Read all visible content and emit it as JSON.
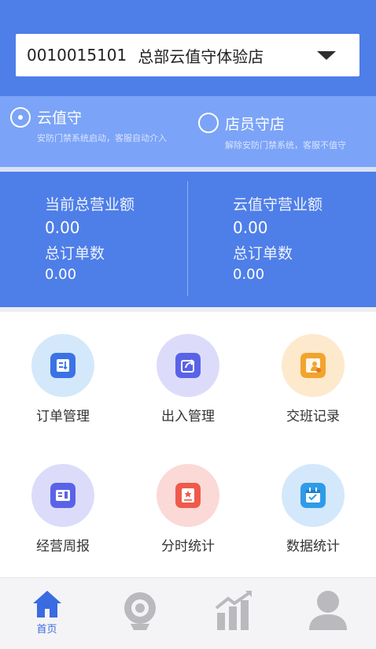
{
  "store": {
    "code": "0010015101",
    "name": "总部云值守体验店"
  },
  "modes": [
    {
      "title": "云值守",
      "desc": "安防门禁系统启动，客服自动介入",
      "selected": true
    },
    {
      "title": "店员守店",
      "desc": "解除安防门禁系统，客服不值守",
      "selected": false
    }
  ],
  "stats": {
    "left": {
      "revenue_label": "当前总营业额",
      "revenue": "0.00",
      "orders_label": "总订单数",
      "orders": "0.00"
    },
    "right": {
      "revenue_label": "云值守营业额",
      "revenue": "0.00",
      "orders_label": "总订单数",
      "orders": "0.00"
    }
  },
  "menu": [
    {
      "label": "订单管理",
      "icon": "order-icon",
      "bg": "#d4e8fb",
      "color": "#3b73e6"
    },
    {
      "label": "出入管理",
      "icon": "share-icon",
      "bg": "#dcdcfa",
      "color": "#5a63e8"
    },
    {
      "label": "交班记录",
      "icon": "handover-icon",
      "bg": "#fde9cc",
      "color": "#f2a42c"
    },
    {
      "label": "经营周报",
      "icon": "report-icon",
      "bg": "#dcdcfa",
      "color": "#5a63e8"
    },
    {
      "label": "分时统计",
      "icon": "stats-icon",
      "bg": "#fbd9d7",
      "color": "#ef5a4c"
    },
    {
      "label": "数据统计",
      "icon": "calendar-icon",
      "bg": "#d4e8fb",
      "color": "#2f9be8"
    }
  ],
  "tabbar": {
    "home_label": "首页",
    "active_color": "#3a6be0",
    "inactive_color": "#b9b9be"
  }
}
